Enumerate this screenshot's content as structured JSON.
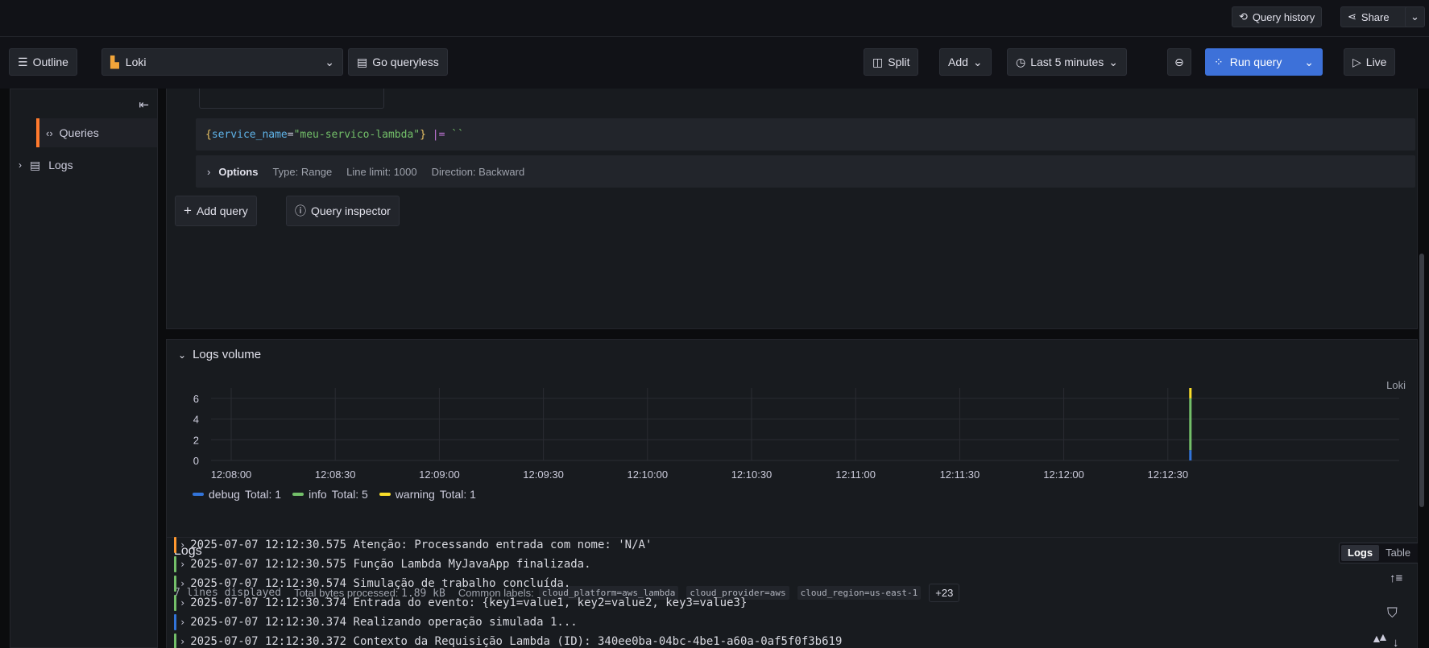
{
  "topbar": {
    "query_history": "Query history",
    "share": "Share"
  },
  "toolbar": {
    "outline": "Outline",
    "datasource": "Loki",
    "go_queryless": "Go queryless",
    "split": "Split",
    "add": "Add",
    "time_range": "Last 5 minutes",
    "run_query": "Run query",
    "live": "Live"
  },
  "sidebar": {
    "items": [
      {
        "label": "Queries",
        "icon": "code-icon"
      },
      {
        "label": "Logs",
        "icon": "logs-icon"
      }
    ]
  },
  "query": {
    "expr_selector_open": "{",
    "expr_key": "service_name",
    "expr_eq": "=",
    "expr_value": "\"meu-servico-lambda\"",
    "expr_selector_close": "}",
    "expr_pipe": "|=",
    "expr_filter": "``",
    "options_label": "Options",
    "type": "Type: Range",
    "line_limit": "Line limit: 1000",
    "direction": "Direction: Backward",
    "add_query": "Add query",
    "query_inspector": "Query inspector"
  },
  "logs_volume": {
    "title": "Logs volume",
    "datasource_label": "Loki"
  },
  "chart_data": {
    "type": "bar",
    "x": [
      "12:08:00",
      "12:08:30",
      "12:09:00",
      "12:09:30",
      "12:10:00",
      "12:10:30",
      "12:11:00",
      "12:11:30",
      "12:12:00",
      "12:12:30"
    ],
    "yticks": [
      0,
      2,
      4,
      6
    ],
    "ylim": [
      0,
      7
    ],
    "stacked": true,
    "series": [
      {
        "name": "debug",
        "total_label": "Total: 1",
        "color": "#3274d9",
        "values": [
          0,
          0,
          0,
          0,
          0,
          0,
          0,
          0,
          0,
          1
        ]
      },
      {
        "name": "info",
        "total_label": "Total: 5",
        "color": "#73bf69",
        "values": [
          0,
          0,
          0,
          0,
          0,
          0,
          0,
          0,
          0,
          5
        ]
      },
      {
        "name": "warning",
        "total_label": "Total: 1",
        "color": "#fade2a",
        "values": [
          0,
          0,
          0,
          0,
          0,
          0,
          0,
          0,
          0,
          1
        ]
      }
    ],
    "grid": true,
    "legend": "bottom-left"
  },
  "logs": {
    "title": "Logs",
    "toggle_logs": "Logs",
    "toggle_table": "Table",
    "lines_displayed": "7 lines displayed",
    "bytes_label": "Total bytes processed:",
    "bytes_value": "1.89 kB",
    "common_labels_label": "Common labels:",
    "common_labels": [
      "cloud_platform=aws_lambda",
      "cloud_provider=aws",
      "cloud_region=us-east-1"
    ],
    "more_labels": "+23",
    "lines": [
      {
        "level_color": "#ff9830",
        "text": "2025-07-07 12:12:30.575 Atenção: Processando entrada com nome: 'N/A'"
      },
      {
        "level_color": "#73bf69",
        "text": "2025-07-07 12:12:30.575 Função Lambda MyJavaApp finalizada."
      },
      {
        "level_color": "#73bf69",
        "text": "2025-07-07 12:12:30.574 Simulação de trabalho concluída."
      },
      {
        "level_color": "#73bf69",
        "text": "2025-07-07 12:12:30.374 Entrada do evento: {key1=value1, key2=value2, key3=value3}"
      },
      {
        "level_color": "#3274d9",
        "text": "2025-07-07 12:12:30.374 Realizando operação simulada 1..."
      },
      {
        "level_color": "#73bf69",
        "text": "2025-07-07 12:12:30.372 Contexto da Requisição Lambda (ID): 340ee0ba-04bc-4be1-a60a-0af5f0f3b619"
      }
    ]
  }
}
